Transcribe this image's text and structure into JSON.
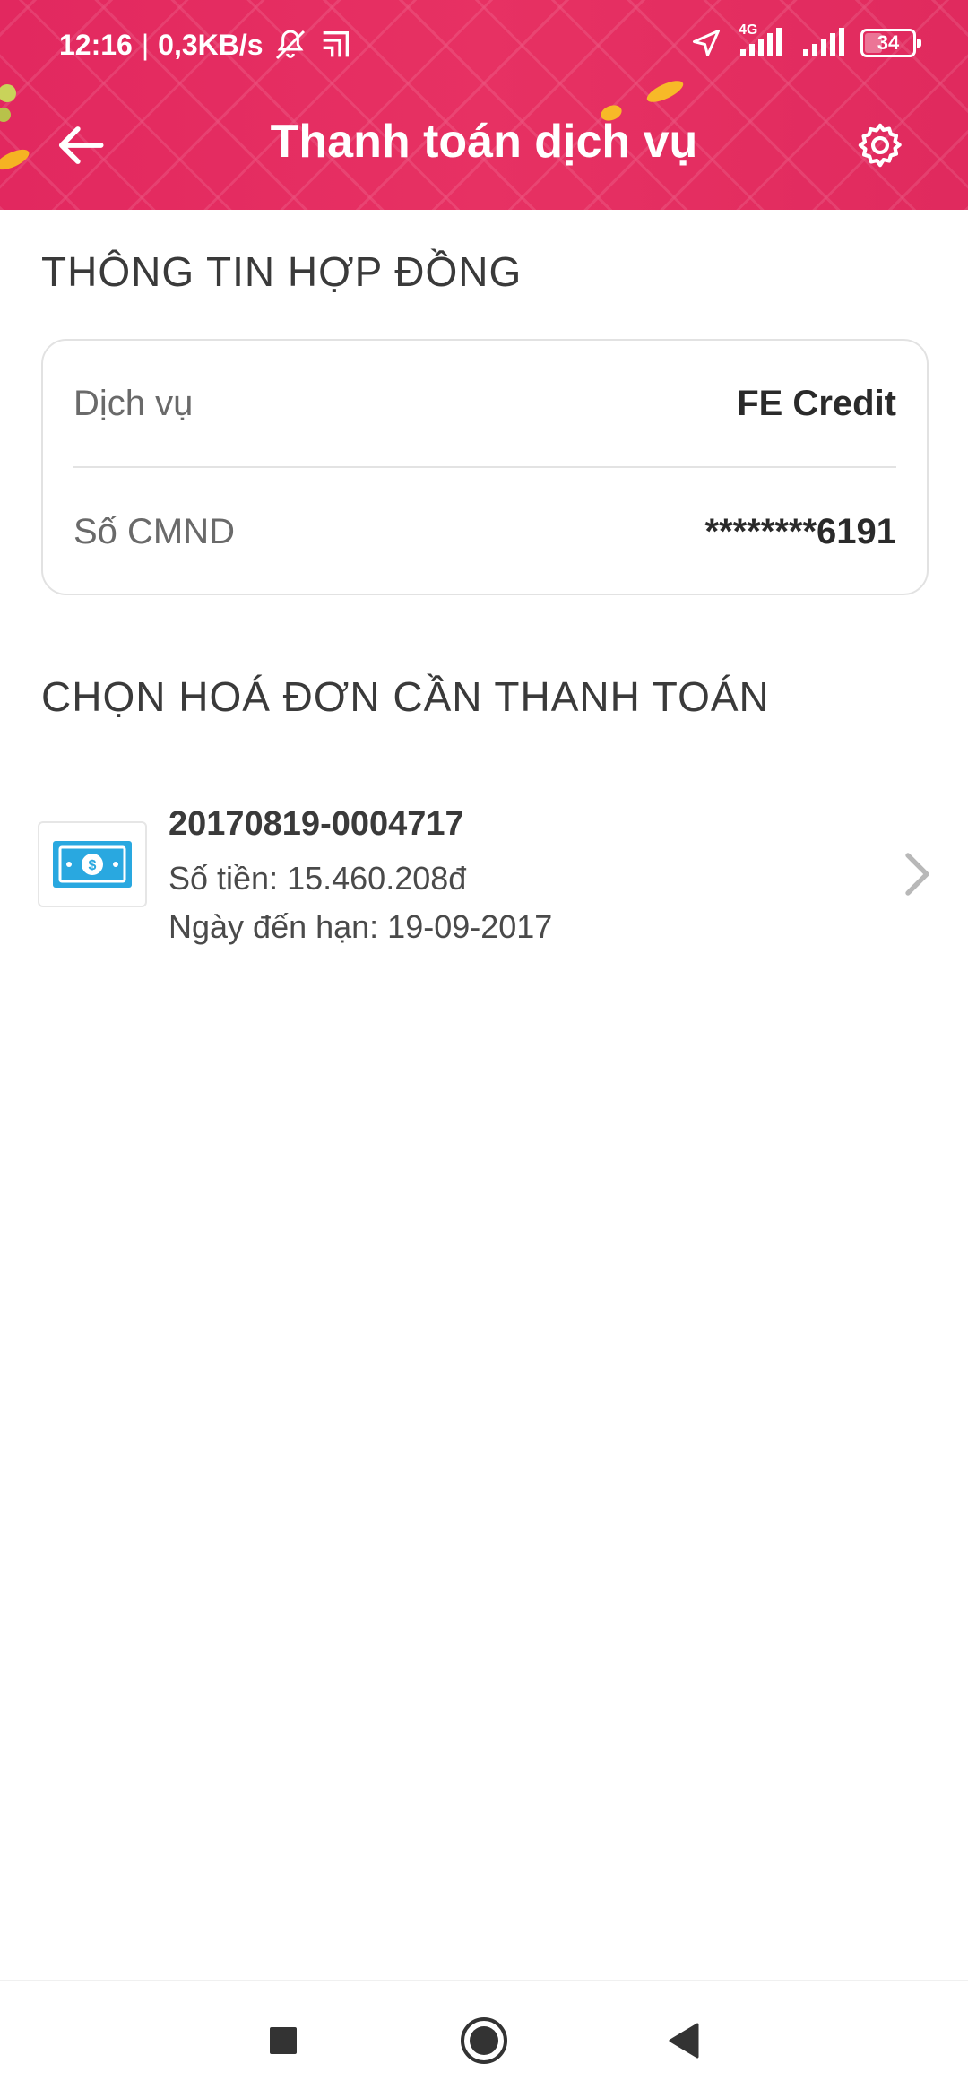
{
  "status_bar": {
    "time": "12:16",
    "separator": "|",
    "network_speed": "0,3KB/s",
    "network_type": "4G",
    "battery": "34",
    "battery_level": 0.34
  },
  "header": {
    "title": "Thanh toán dịch vụ",
    "back_icon": "arrow-left-icon",
    "settings_icon": "gear-icon",
    "background_color": "#e32b60"
  },
  "contract": {
    "section_title": "THÔNG TIN HỢP ĐỒNG",
    "rows": [
      {
        "label": "Dịch vụ",
        "value": "FE Credit"
      },
      {
        "label": "Số CMND",
        "value": "********6191"
      }
    ]
  },
  "bills": {
    "section_title": "CHỌN HOÁ ĐƠN CẦN THANH TOÁN",
    "items": [
      {
        "id": "20170819-0004717",
        "amount": "Số tiền: 15.460.208đ",
        "due_date": "Ngày đến hạn: 19-09-2017",
        "icon": "money-bill-icon",
        "icon_color": "#29a8e0"
      }
    ]
  },
  "nav": {
    "recents_icon": "square-icon",
    "home_icon": "circle-icon",
    "back_icon": "triangle-back-icon"
  }
}
